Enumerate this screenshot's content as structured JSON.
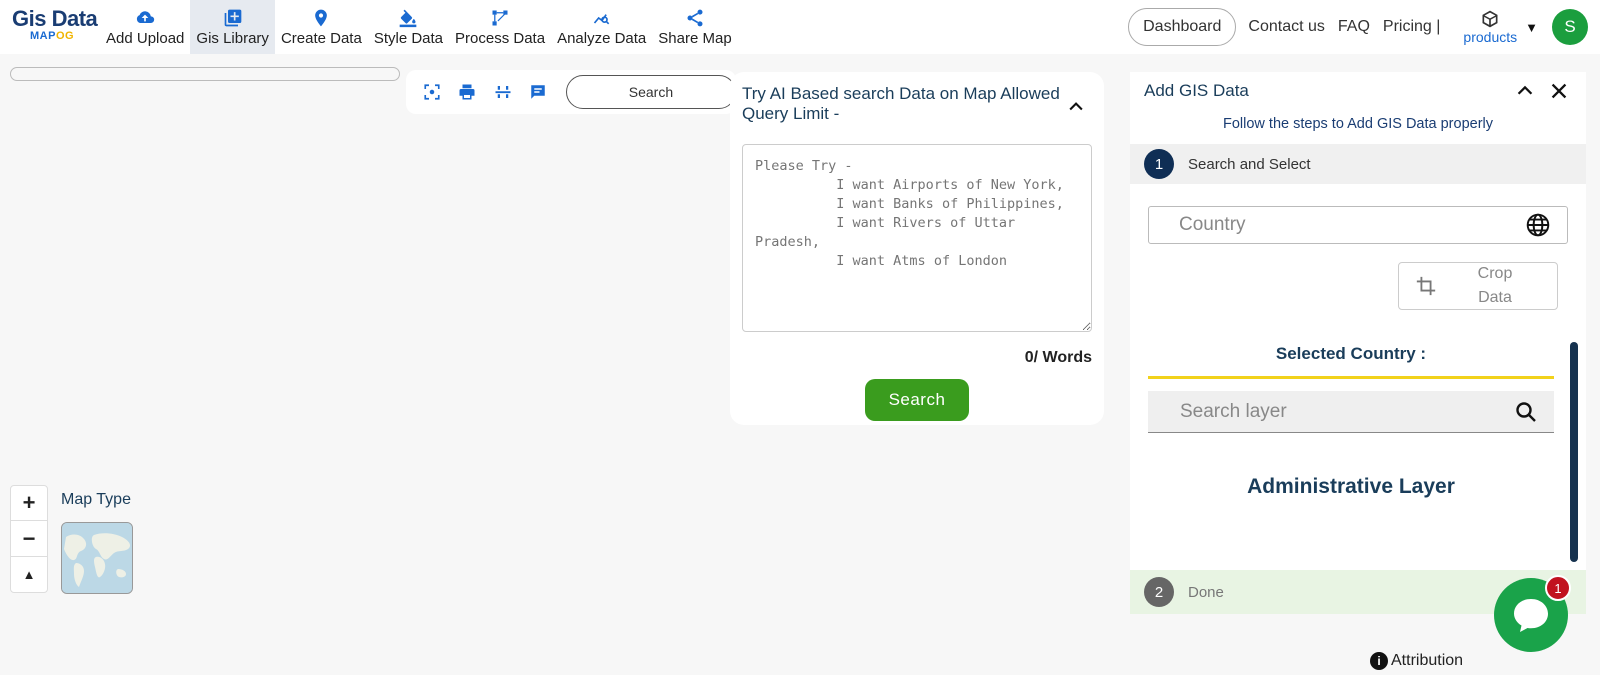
{
  "logo": {
    "title": "Gis Data",
    "sub_prefix": "MAP",
    "sub_suffix": "OG"
  },
  "nav": {
    "items": [
      {
        "label": "Add Upload",
        "icon": "cloud-upload-icon"
      },
      {
        "label": "Gis Library",
        "icon": "library-add-icon",
        "active": true
      },
      {
        "label": "Create Data",
        "icon": "map-pin-icon"
      },
      {
        "label": "Style Data",
        "icon": "paint-bucket-icon"
      },
      {
        "label": "Process Data",
        "icon": "process-icon"
      },
      {
        "label": "Analyze Data",
        "icon": "analyze-icon"
      },
      {
        "label": "Share Map",
        "icon": "share-icon"
      }
    ],
    "dashboard": "Dashboard",
    "contact": "Contact us",
    "faq": "FAQ",
    "pricing": "Pricing |",
    "products": "products",
    "avatar": "S"
  },
  "toolbar": {
    "search_label": "Search"
  },
  "ai_panel": {
    "title": "Try AI Based search Data on Map Allowed Query Limit -",
    "placeholder": "Please Try -\n          I want Airports of New York,\n          I want Banks of Philippines,\n          I want Rivers of Uttar Pradesh,\n          I want Atms of London",
    "word_count": "0/ Words",
    "search_button": "Search"
  },
  "gis_panel": {
    "title": "Add GIS Data",
    "subtitle": "Follow the steps to Add GIS Data properly",
    "step1": {
      "number": "1",
      "label": "Search and Select"
    },
    "country_placeholder": "Country",
    "crop_label": "Crop Data",
    "selected_country": "Selected Country :",
    "layer_placeholder": "Search layer",
    "admin_layer": "Administrative Layer",
    "step2": {
      "number": "2",
      "label": "Done"
    }
  },
  "chat": {
    "badge": "1"
  },
  "attribution": "Attribution",
  "map_controls": {
    "zoom_in": "+",
    "zoom_out": "−",
    "compass": "▲",
    "map_type_label": "Map Type"
  },
  "colors": {
    "brand_dark": "#1a3d73",
    "accent_green": "#3a9c1e",
    "badge_red": "#c1121f",
    "highlight_yellow": "#f2d21b"
  }
}
